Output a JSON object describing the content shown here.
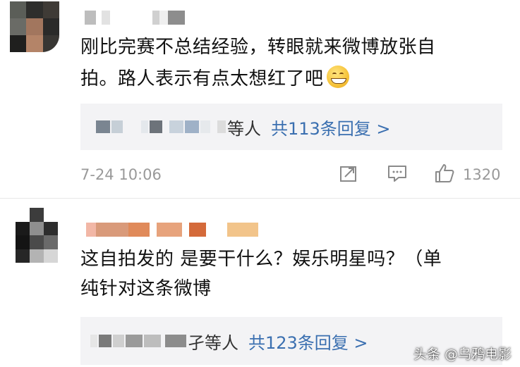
{
  "comments": [
    {
      "text_lines": [
        "刚比完赛不总结经验，转眼就来微博放张自",
        "拍。路人表示有点太想红了吧"
      ],
      "emoji": "grin-sweat-emoji",
      "replies": {
        "users_suffix": "等人",
        "count_text": "共113条回复 >"
      },
      "timestamp": "7-24 10:06",
      "likes": "1320"
    },
    {
      "text_lines": [
        "这自拍发的 是要干什么？娱乐明星吗？（单",
        "纯针对这条微博"
      ],
      "replies": {
        "users_suffix": "孑等人",
        "count_text": "共123条回复 >"
      }
    }
  ],
  "icons": {
    "share": "share-icon",
    "comment": "comment-icon",
    "like": "thumbs-up-icon"
  },
  "watermark": "头条 @乌鸦电影",
  "colors": {
    "link": "#3a6fb0",
    "meta": "#999999",
    "reply_bg": "#f3f3f5"
  }
}
